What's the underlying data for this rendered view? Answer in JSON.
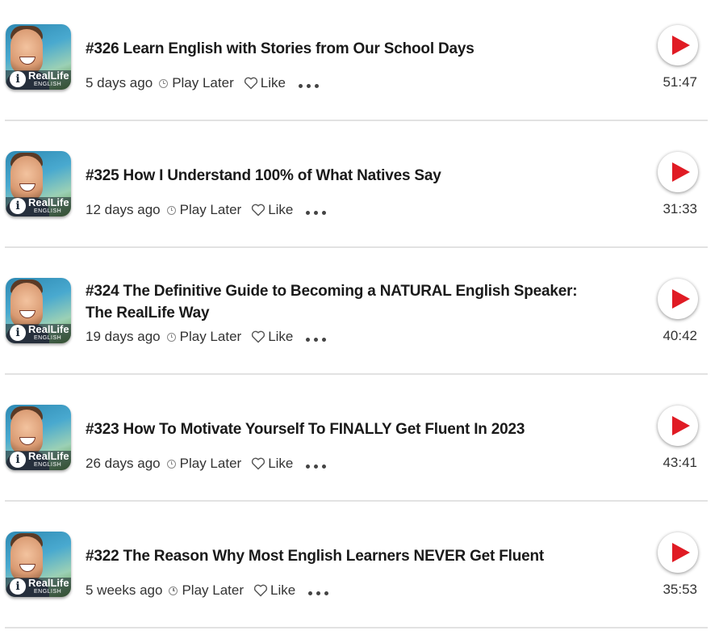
{
  "colors": {
    "accent": "#e01b24",
    "divider": "#e2e2e2",
    "text": "#1a1a1a"
  },
  "thumbnail": {
    "brand": "RealLife",
    "brand_sub": "ENGLISH",
    "logo_mark": "i"
  },
  "actions": {
    "play_later": "Play Later",
    "like": "Like"
  },
  "episodes": [
    {
      "title": "#326 Learn English with Stories from Our School Days",
      "age": "5 days ago",
      "duration": "51:47"
    },
    {
      "title": "#325 How I Understand 100% of What Natives Say",
      "age": "12 days ago",
      "duration": "31:33"
    },
    {
      "title": "#324 The Definitive Guide to Becoming a NATURAL English Speaker: The RealLife Way",
      "age": "19 days ago",
      "duration": "40:42"
    },
    {
      "title": "#323 How To Motivate Yourself To FINALLY Get Fluent In 2023",
      "age": "26 days ago",
      "duration": "43:41"
    },
    {
      "title": "#322 The Reason Why Most English Learners NEVER Get Fluent",
      "age": "5 weeks ago",
      "duration": "35:53"
    }
  ]
}
